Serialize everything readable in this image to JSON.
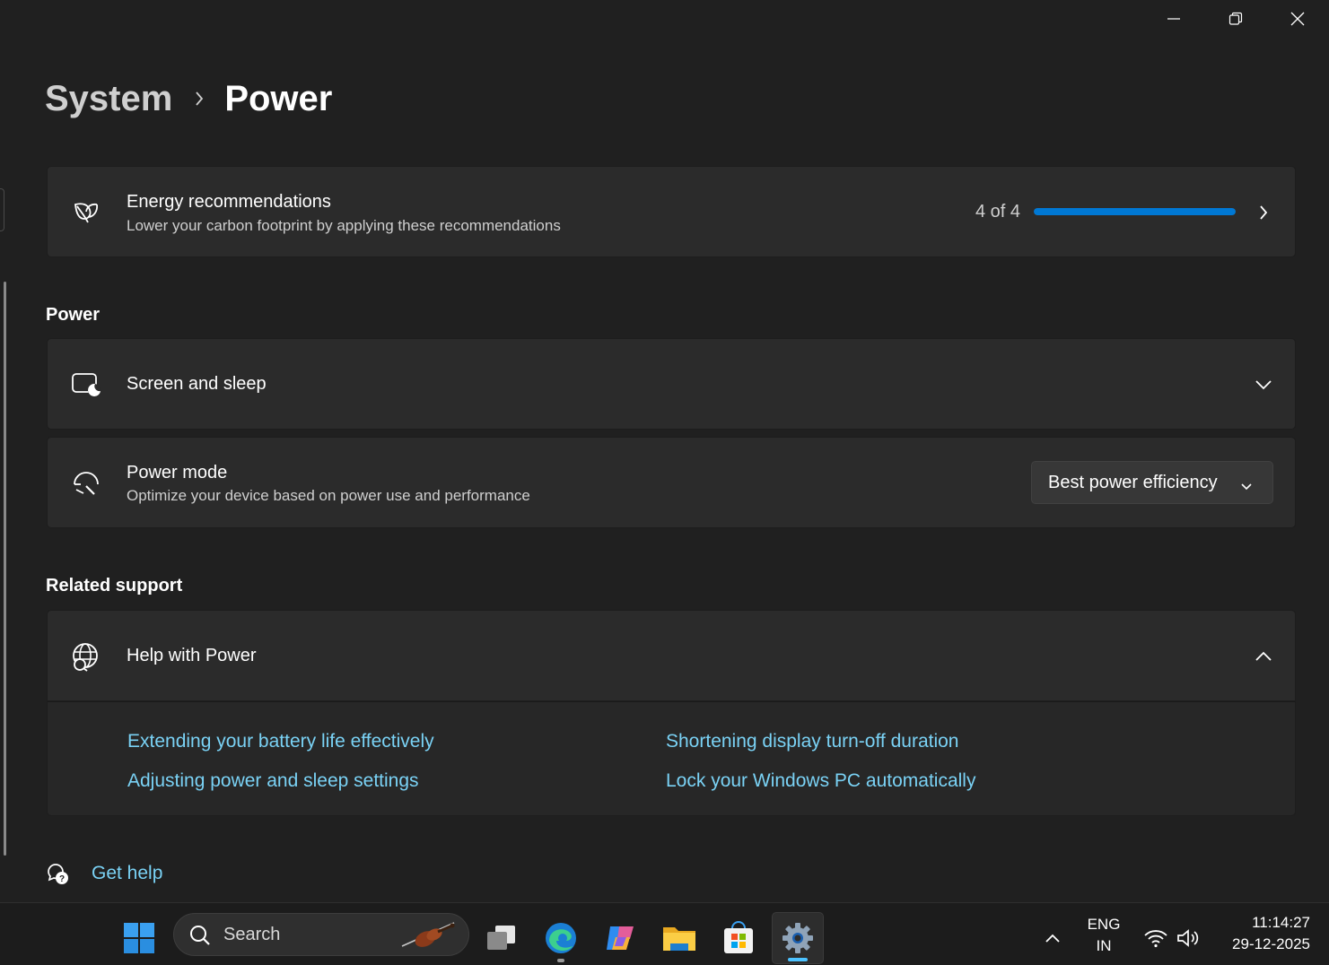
{
  "window": {
    "minimize_icon": "minimize-icon",
    "maximize_icon": "restore-icon",
    "close_icon": "close-icon"
  },
  "breadcrumb": {
    "parent": "System",
    "current": "Power"
  },
  "energy": {
    "title": "Energy recommendations",
    "subtitle": "Lower your carbon footprint by applying these recommendations",
    "progress_text": "4 of 4",
    "progress_fraction": 1.0,
    "accent": "#0078d4"
  },
  "power_section": {
    "heading": "Power",
    "screen_sleep": {
      "title": "Screen and sleep"
    },
    "power_mode": {
      "title": "Power mode",
      "subtitle": "Optimize your device based on power use and performance",
      "selected": "Best power efficiency"
    }
  },
  "related": {
    "heading": "Related support",
    "help_title": "Help with Power",
    "links": [
      "Extending your battery life effectively",
      "Shortening display turn-off duration",
      "Adjusting power and sleep settings",
      "Lock your Windows PC automatically"
    ],
    "link_color": "#7ad2f5"
  },
  "get_help": {
    "label": "Get help"
  },
  "taskbar": {
    "search_label": "Search",
    "language_top": "ENG",
    "language_bottom": "IN",
    "time": "11:14:27",
    "date": "29-12-2025"
  }
}
